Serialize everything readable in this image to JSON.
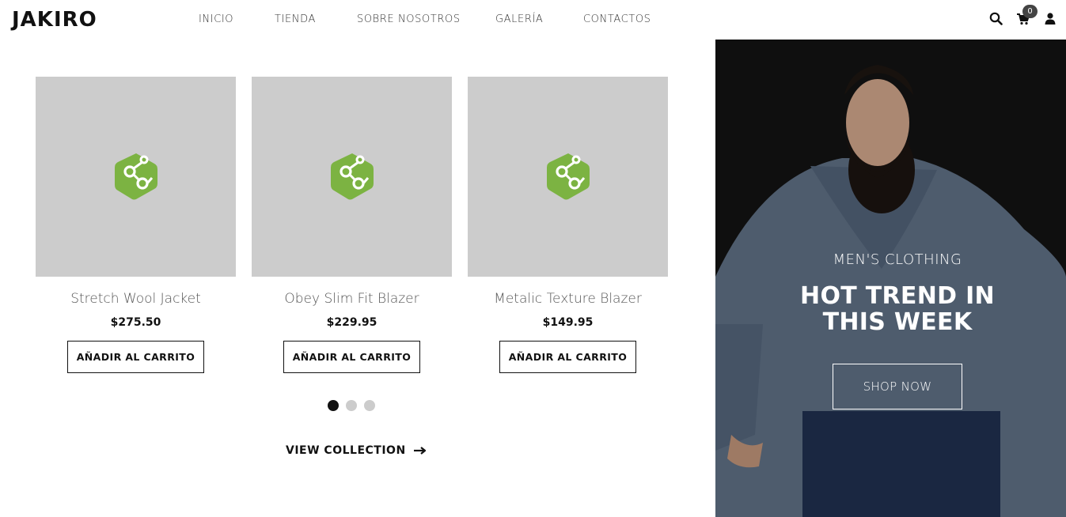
{
  "header": {
    "logo": "JAKIRO",
    "nav": [
      "INICIO",
      "TIENDA",
      "SOBRE NOSOTROS",
      "GALERÍA",
      "CONTACTOS"
    ],
    "icons": [
      "search-icon",
      "cart-icon",
      "user-icon"
    ],
    "cart_count": "0"
  },
  "products": [
    {
      "name": "Stretch Wool Jacket",
      "price": "$275.50",
      "button": "AÑADIR AL CARRITO"
    },
    {
      "name": "Obey Slim Fit Blazer",
      "price": "$229.95",
      "button": "AÑADIR AL CARRITO"
    },
    {
      "name": "Metalic Texture Blazer",
      "price": "$149.95",
      "button": "AÑADIR AL CARRITO"
    }
  ],
  "carousel": {
    "pages": 3,
    "active": 1
  },
  "view_collection": "VIEW COLLECTION",
  "banner": {
    "kicker": "MEN'S CLOTHING",
    "headline_line1": "HOT TREND IN",
    "headline_line2": "THIS WEEK",
    "button": "SHOP NOW"
  },
  "colors": {
    "placeholder_bg": "#cccccc",
    "placeholder_icon": "#7cb342",
    "text_dark": "#111111",
    "banner_bg": "#121212"
  }
}
